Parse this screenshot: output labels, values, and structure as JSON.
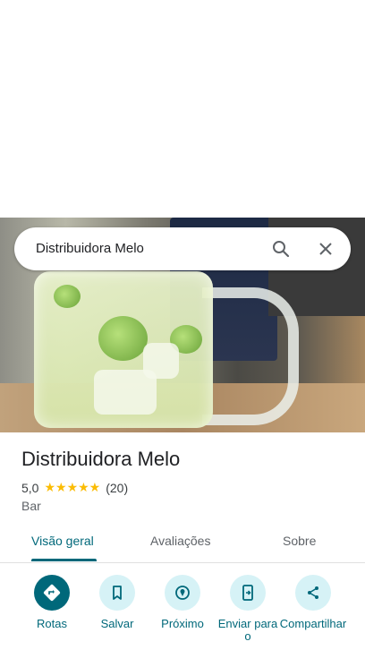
{
  "search": {
    "query": "Distribuidora Melo"
  },
  "place": {
    "name": "Distribuidora Melo",
    "rating": "5,0",
    "stars": "★★★★★",
    "reviews_count": "(20)",
    "category": "Bar"
  },
  "tabs": [
    {
      "label": "Visão geral"
    },
    {
      "label": "Avaliações"
    },
    {
      "label": "Sobre"
    }
  ],
  "actions": [
    {
      "label": "Rotas"
    },
    {
      "label": "Salvar"
    },
    {
      "label": "Próximo"
    },
    {
      "label": "Enviar para o"
    },
    {
      "label": "Compartilhar"
    }
  ],
  "colors": {
    "accent": "#00687a",
    "chip": "#d6f2f6",
    "star": "#fbbc04"
  }
}
